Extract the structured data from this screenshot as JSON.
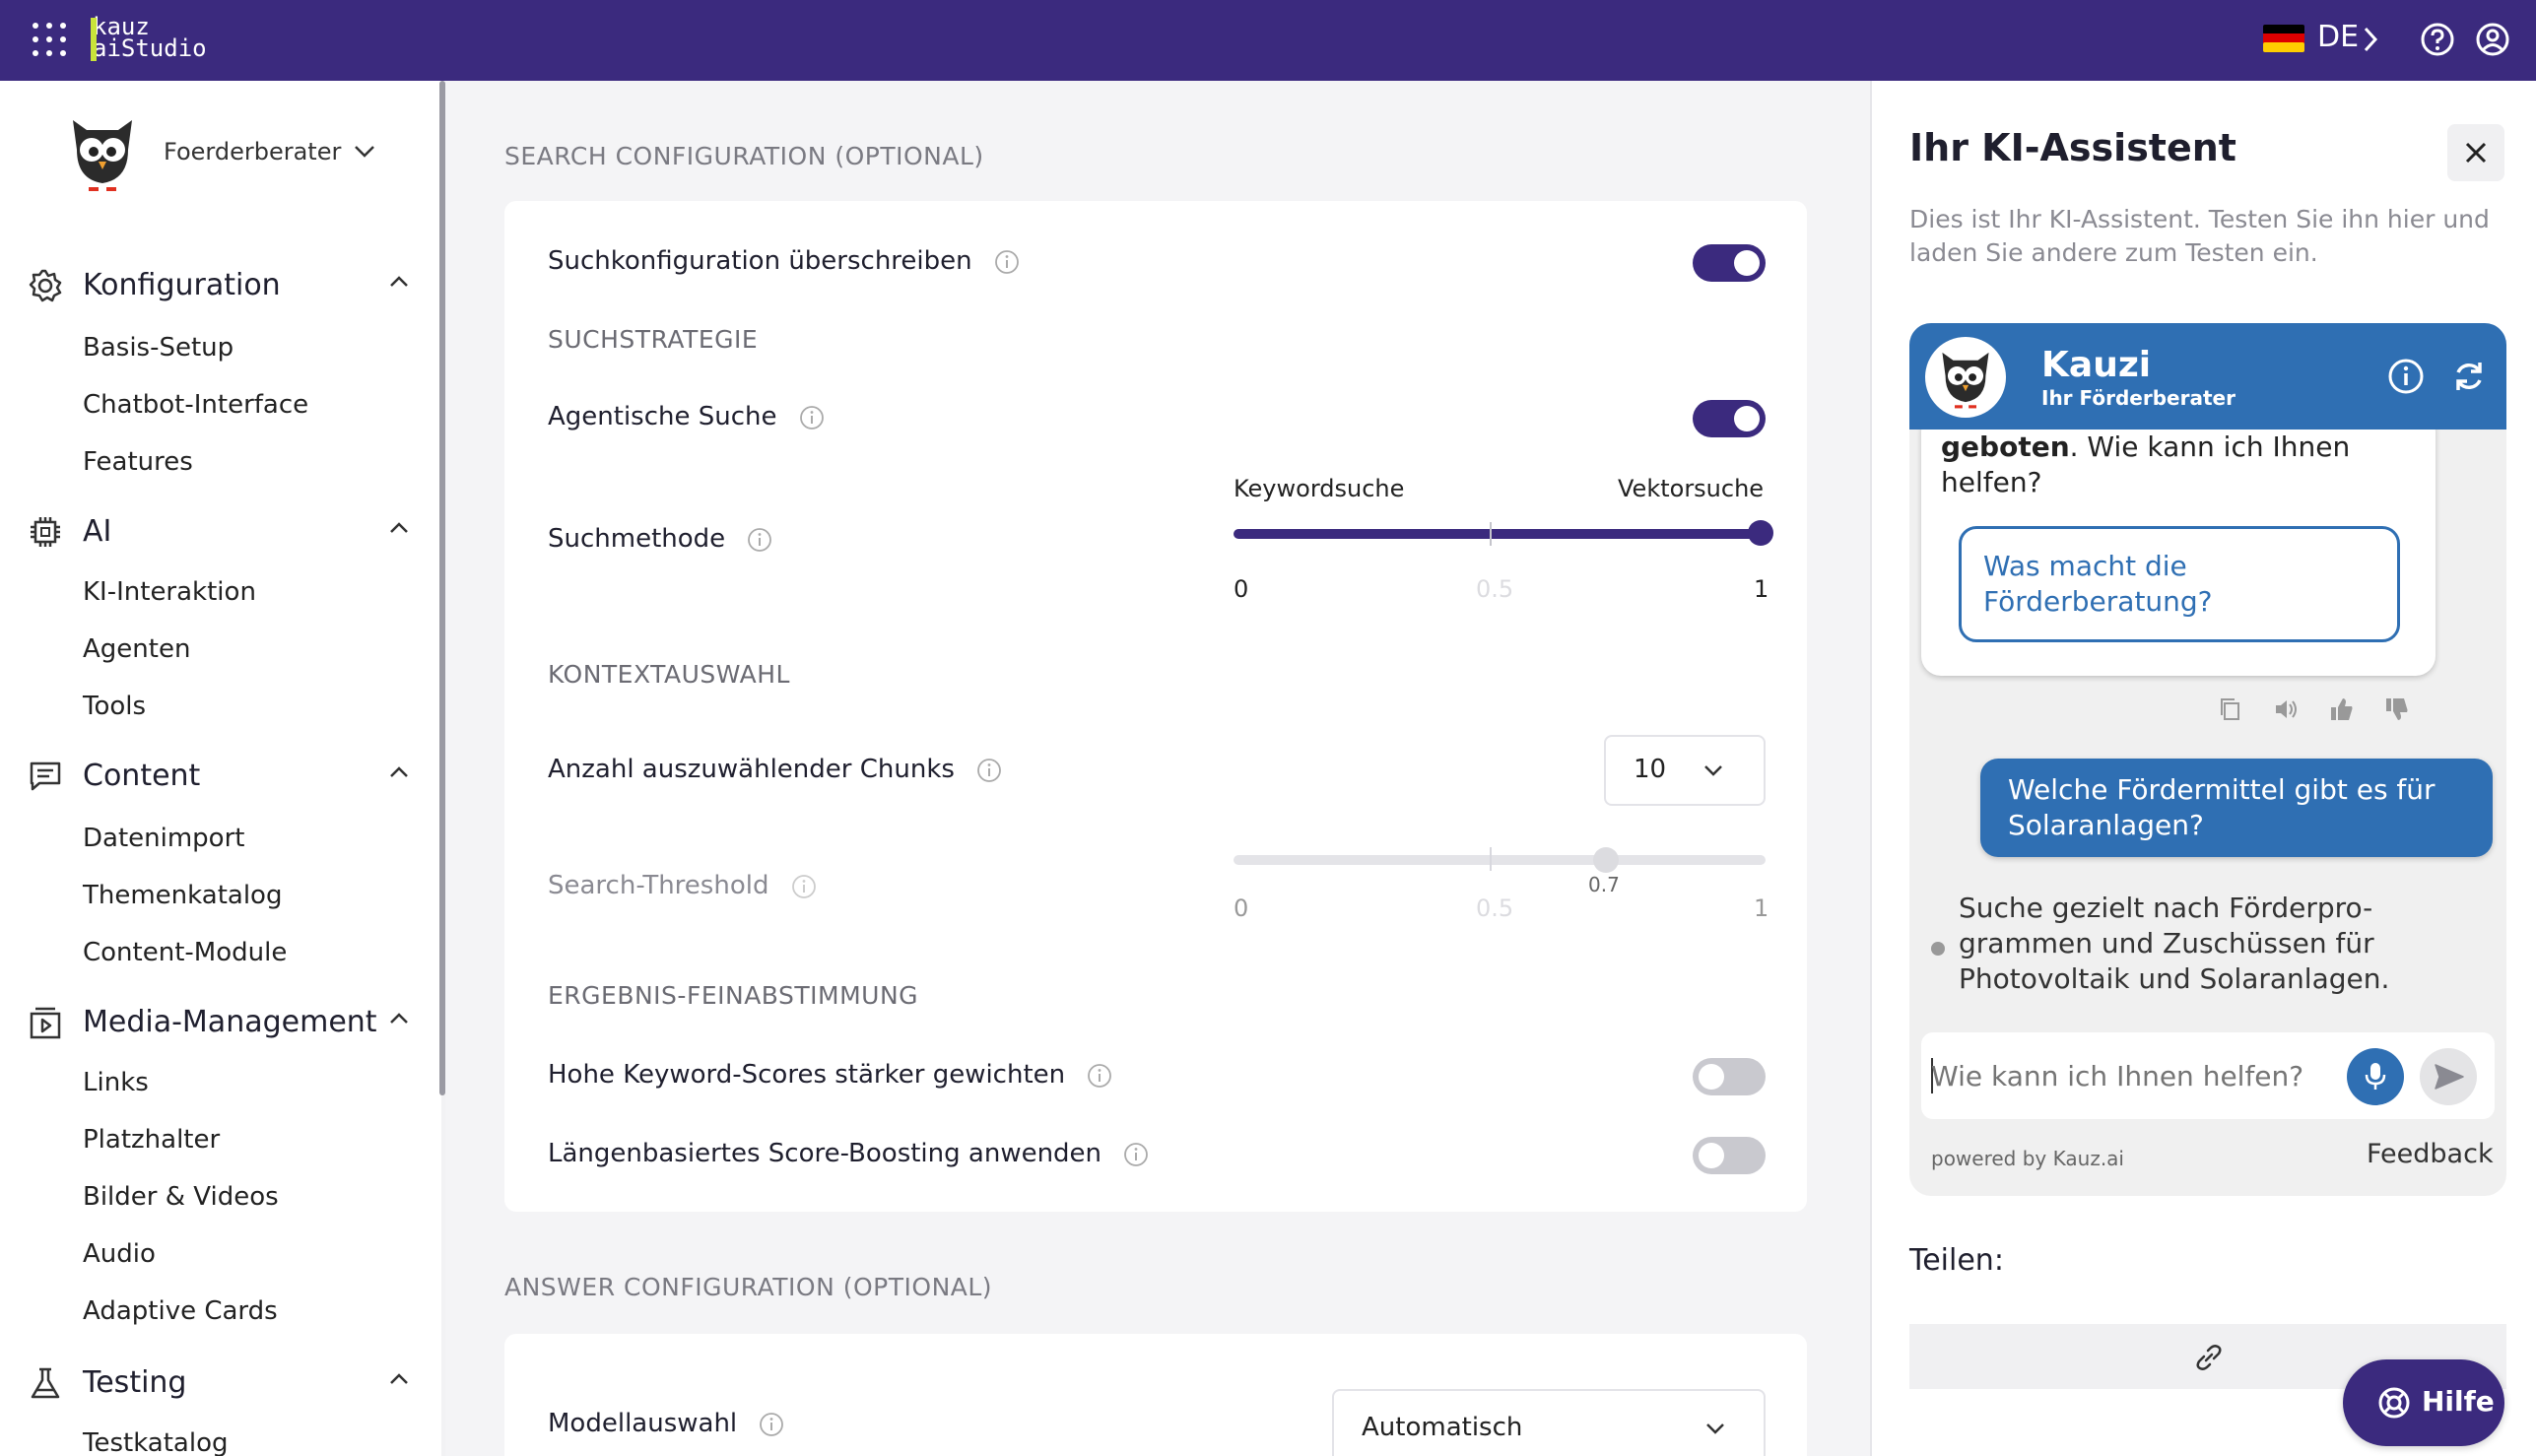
{
  "topbar": {
    "logo_line1": "kauz",
    "logo_line2": "aiStudio",
    "language": "DE",
    "colors": {
      "bar": "#3b2a7e",
      "logo_accent": "#c9e33a"
    },
    "icons": [
      "apps-grid-icon",
      "germany-flag-icon",
      "chevron-right-icon",
      "help-icon",
      "user-icon"
    ]
  },
  "sidebar": {
    "agent_name": "Foerderberater",
    "sections": [
      {
        "title": "Konfiguration",
        "icon": "gear-icon",
        "items": [
          "Basis-Setup",
          "Chatbot-Interface",
          "Features"
        ]
      },
      {
        "title": "AI",
        "icon": "chip-icon",
        "items": [
          "KI-Interaktion",
          "Agenten",
          "Tools"
        ]
      },
      {
        "title": "Content",
        "icon": "chat-list-icon",
        "items": [
          "Datenimport",
          "Themenkatalog",
          "Content-Module"
        ]
      },
      {
        "title": "Media-Management",
        "icon": "media-icon",
        "items": [
          "Links",
          "Platzhalter",
          "Bilder & Videos",
          "Audio",
          "Adaptive Cards"
        ]
      },
      {
        "title": "Testing",
        "icon": "flask-icon",
        "items": [
          "Testkatalog"
        ]
      }
    ]
  },
  "main": {
    "search_heading": "SEARCH CONFIGURATION (OPTIONAL)",
    "override_label": "Suchkonfiguration überschreiben",
    "override_on": true,
    "strategy_heading": "SUCHSTRATEGIE",
    "agentic_label": "Agentische Suche",
    "agentic_on": true,
    "method_label": "Suchmethode",
    "method_left": "Keywordsuche",
    "method_right": "Vektorsuche",
    "method_value": 1,
    "method_min": "0",
    "method_mid": "0.5",
    "method_max": "1",
    "context_heading": "KONTEXTAUSWAHL",
    "chunks_label": "Anzahl auszuwählender Chunks",
    "chunks_value": "10",
    "threshold_label": "Search-Threshold",
    "threshold_value": 0.7,
    "threshold_value_label": "0.7",
    "threshold_min": "0",
    "threshold_mid": "0.5",
    "threshold_max": "1",
    "tuning_heading": "ERGEBNIS-FEINABSTIMMUNG",
    "keyword_boost_label": "Hohe Keyword-Scores stärker gewichten",
    "keyword_boost_on": false,
    "length_boost_label": "Längenbasiertes Score-Boosting anwenden",
    "length_boost_on": false,
    "answer_heading": "ANSWER CONFIGURATION (OPTIONAL)",
    "model_label": "Modellauswahl",
    "model_value": "Automatisch",
    "colors": {
      "accent": "#3b2a7e",
      "toggle_off": "#c9c9cf"
    }
  },
  "assistant": {
    "title": "Ihr KI-Assistent",
    "description": "Dies ist Ihr KI-Assistent. Testen Sie ihn hier und laden Sie andere zum Testen ein.",
    "bot_name": "Kauzi",
    "bot_subtitle": "Ihr Förderberater",
    "msg_bold": "geboten",
    "msg_rest": ". Wie kann ich Ihnen helfen?",
    "quick_reply": "Was macht die Förderberatung?",
    "user_message": "Welche Fördermittel gibt es für Solaranlagen?",
    "bot_thinking": "Suche gezielt nach Förderpro-grammen und Zuschüssen für Photovoltaik und Solaranlagen.",
    "input_placeholder": "Wie kann ich Ihnen helfen?",
    "powered_by": "powered by Kauz.ai",
    "feedback": "Feedback",
    "share_label": "Teilen:",
    "help_button": "Hilfe",
    "colors": {
      "chat_blue": "#2f6fb3"
    }
  }
}
